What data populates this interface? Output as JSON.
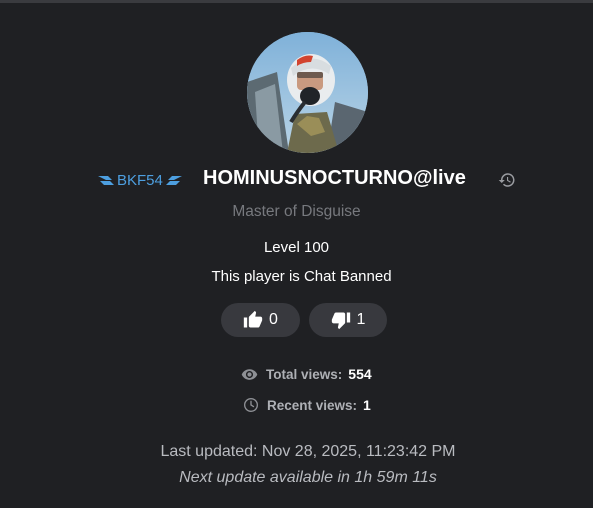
{
  "profile": {
    "clan_tag": "BKF54",
    "player_name": "HOMINUSNOCTURNO@live",
    "title": "Master of Disguise",
    "level": "Level 100",
    "chat_status": "This player is Chat Banned"
  },
  "votes": {
    "likes": "0",
    "dislikes": "1"
  },
  "stats": {
    "total_views_label": "Total views:",
    "total_views_value": "554",
    "recent_views_label": "Recent views:",
    "recent_views_value": "1"
  },
  "footer": {
    "last_updated": "Last updated: Nov 28, 2025, 11:23:42 PM",
    "next_update": "Next update available in 1h 59m 11s"
  },
  "colors": {
    "background": "#1f2023",
    "clan_blue": "#4d9fe0",
    "muted_text": "#77797e",
    "button_bg": "#38393e"
  },
  "icons": {
    "history": "history-icon",
    "like": "thumbs-up-icon",
    "dislike": "thumbs-down-icon",
    "views": "eye-icon",
    "recent": "clock-icon"
  }
}
